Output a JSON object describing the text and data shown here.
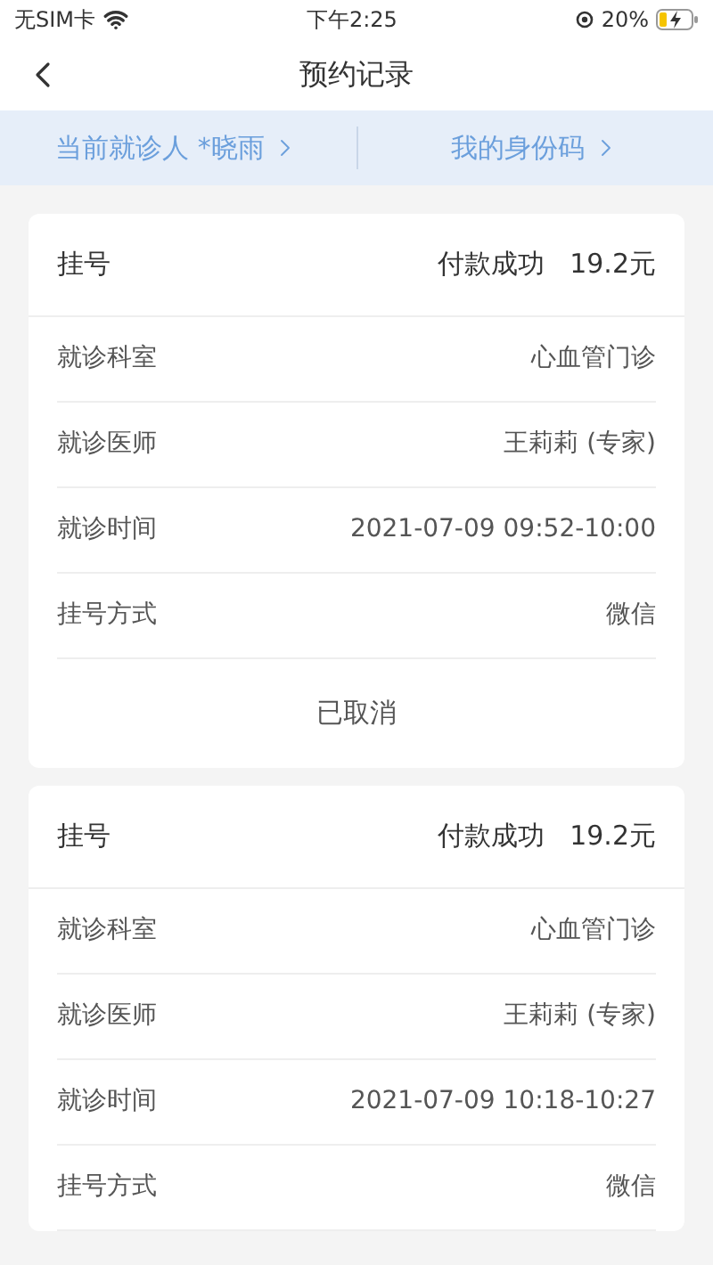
{
  "status_bar": {
    "carrier": "无SIM卡",
    "time": "下午2:25",
    "battery": "20%"
  },
  "nav": {
    "title": "预约记录"
  },
  "banner": {
    "patient": "当前就诊人 *晓雨",
    "id_code": "我的身份码"
  },
  "records": [
    {
      "type": "挂号",
      "status": "付款成功",
      "amount": "19.2元",
      "rows": [
        {
          "label": "就诊科室",
          "value": "心血管门诊"
        },
        {
          "label": "就诊医师",
          "value": "王莉莉 (专家)"
        },
        {
          "label": "就诊时间",
          "value": "2021-07-09 09:52-10:00"
        },
        {
          "label": "挂号方式",
          "value": "微信"
        }
      ],
      "footer": "已取消"
    },
    {
      "type": "挂号",
      "status": "付款成功",
      "amount": "19.2元",
      "rows": [
        {
          "label": "就诊科室",
          "value": "心血管门诊"
        },
        {
          "label": "就诊医师",
          "value": "王莉莉 (专家)"
        },
        {
          "label": "就诊时间",
          "value": "2021-07-09 10:18-10:27"
        },
        {
          "label": "挂号方式",
          "value": "微信"
        }
      ]
    }
  ]
}
